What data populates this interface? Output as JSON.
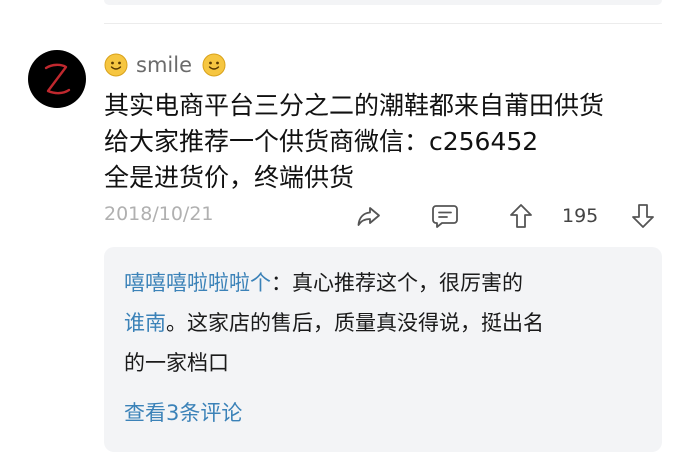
{
  "comment": {
    "username": "smile",
    "lines": [
      "其实电商平台三分之二的潮鞋都来自莆田供货",
      "给大家推荐一个供货商微信：c256452",
      "全是进货价，终端供货"
    ],
    "date": "2018/10/21",
    "like_count": "195"
  },
  "reply": {
    "author": "嘻嘻嘻啦啦啦个",
    "colon": "：",
    "text_line1": "真心推荐这个，很厉害的",
    "mention": "谁南",
    "text_line2": "。这家店的售后，质量真没得说，挺出名",
    "text_line3": "的一家档口",
    "view_more": "查看3条评论"
  },
  "icons": {
    "share": "share-icon",
    "reply": "comment-icon",
    "like": "thumb-up-arrow-icon",
    "dislike": "thumb-down-arrow-icon"
  },
  "colors": {
    "link_blue": "#3b82b8",
    "meta_gray": "#b0b0b0",
    "reply_bg": "#f3f4f6"
  }
}
